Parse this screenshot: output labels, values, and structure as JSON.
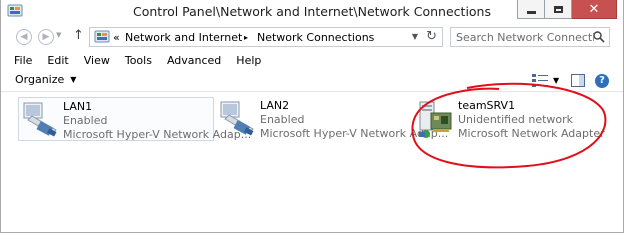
{
  "window": {
    "title": "Control Panel\\Network and Internet\\Network Connections",
    "buttons": {
      "minimize": "minimize",
      "maximize": "maximize",
      "close": "✕"
    }
  },
  "nav": {
    "back": "back",
    "forward": "forward",
    "breadcrumb": {
      "prefix": "«",
      "items": [
        "Network and Internet",
        "Network Connections"
      ],
      "separator": "▸"
    },
    "search_placeholder": "Search Network Connections"
  },
  "menu": [
    "File",
    "Edit",
    "View",
    "Tools",
    "Advanced",
    "Help"
  ],
  "commandbar": {
    "organize": "Organize",
    "caret": "▼",
    "help": "?"
  },
  "connections": [
    {
      "name": "LAN1",
      "status": "Enabled",
      "adapter": "Microsoft Hyper-V Network Adap...",
      "icon": "network-adapter-icon",
      "selected": true
    },
    {
      "name": "LAN2",
      "status": "Enabled",
      "adapter": "Microsoft Hyper-V Network Adap...",
      "icon": "network-adapter-icon",
      "selected": false
    },
    {
      "name": "teamSRV1",
      "status": "Unidentified network",
      "adapter": "Microsoft Network Adapter Multi...",
      "icon": "team-adapter-icon",
      "selected": false,
      "annotated": true
    }
  ],
  "colors": {
    "annotation": "#e0101a",
    "close_button": "#c75050",
    "help": "#2f6fb9",
    "secondary_text": "#6d6d6d"
  }
}
